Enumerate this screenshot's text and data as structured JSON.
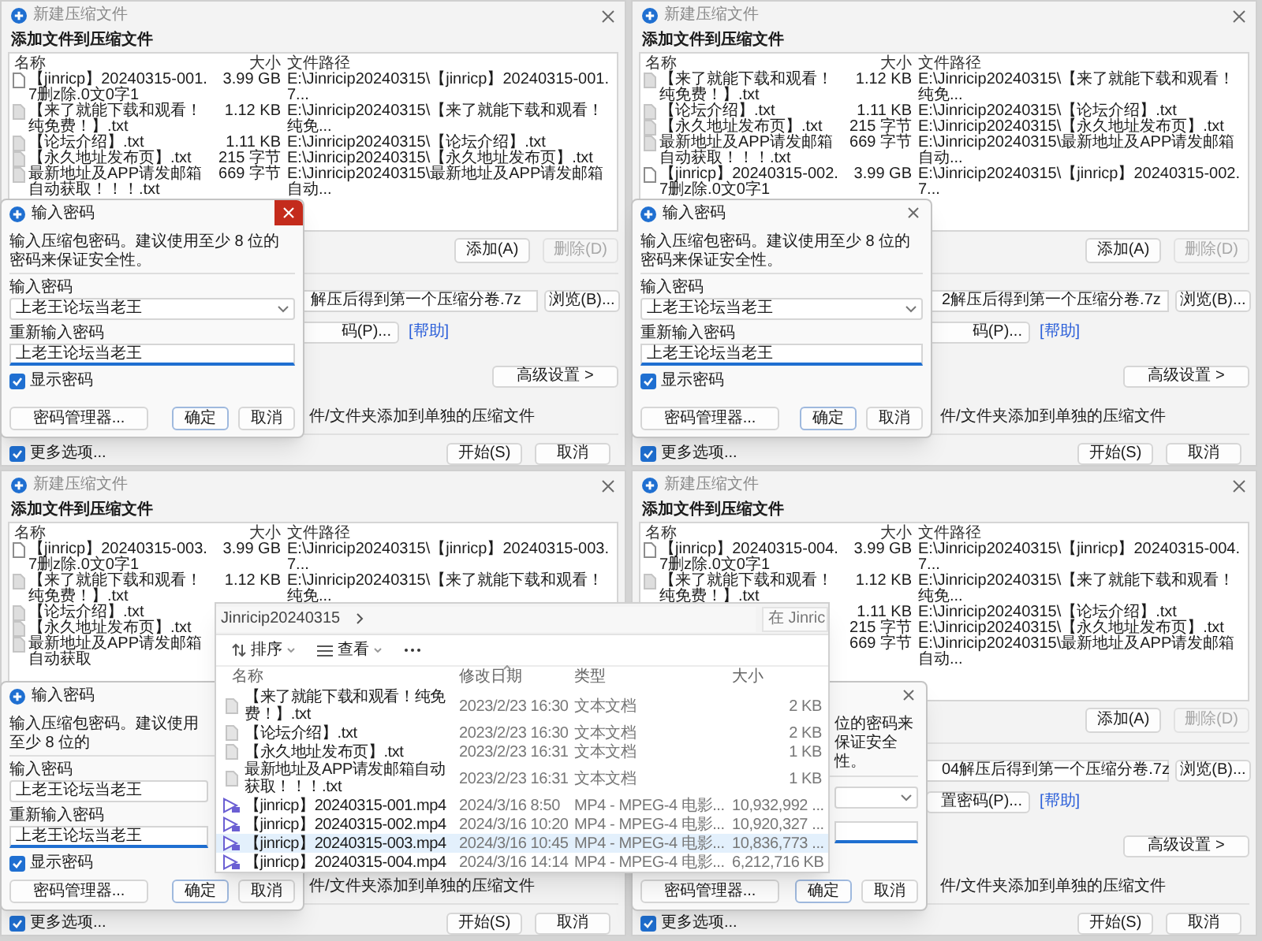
{
  "windows": [
    {
      "title": "新建压缩文件",
      "heading": "添加文件到压缩文件",
      "columns": [
        "名称",
        "大小",
        "文件路径"
      ],
      "rows": [
        {
          "kind": "archive",
          "name": "【jinricp】20240315-001.7删z除.0文0字1",
          "size": "3.99 GB",
          "path": "E:\\Jinricip20240315\\【jinricp】20240315-001.7..."
        },
        {
          "kind": "text",
          "name": "【来了就能下载和观看！纯免费！】.txt",
          "size": "1.12 KB",
          "path": "E:\\Jinricip20240315\\【来了就能下载和观看！纯免..."
        },
        {
          "kind": "text",
          "name": "【论坛介绍】.txt",
          "size": "1.11 KB",
          "path": "E:\\Jinricip20240315\\【论坛介绍】.txt"
        },
        {
          "kind": "text",
          "name": "【永久地址发布页】.txt",
          "size": "215 字节",
          "path": "E:\\Jinricip20240315\\【永久地址发布页】.txt"
        },
        {
          "kind": "text",
          "name": "最新地址及APP请发邮箱自动获取！！！.txt",
          "size": "669 字节",
          "path": "E:\\Jinricip20240315\\最新地址及APP请发邮箱自动..."
        }
      ],
      "add_button": "添加(A)",
      "delete_button": {
        "label": "删除(D)",
        "disabled": true
      },
      "archive_path": "解压后得到第一个压缩分卷.7z",
      "browse_button": "浏览(B)...",
      "password_button": "码(P)...",
      "help_link": "[帮助]",
      "advanced_button": "高级设置 >",
      "single_archive_option": "件/文件夹添加到单独的压缩文件",
      "more_options": {
        "label": "更多选项...",
        "checked": true
      },
      "start_button": "开始(S)",
      "cancel_button": "取消"
    },
    {
      "title": "新建压缩文件",
      "heading": "添加文件到压缩文件",
      "columns": [
        "名称",
        "大小",
        "文件路径"
      ],
      "rows": [
        {
          "kind": "text",
          "name": "【来了就能下载和观看！纯免费！】.txt",
          "size": "1.12 KB",
          "path": "E:\\Jinricip20240315\\【来了就能下载和观看！纯免..."
        },
        {
          "kind": "text",
          "name": "【论坛介绍】.txt",
          "size": "1.11 KB",
          "path": "E:\\Jinricip20240315\\【论坛介绍】.txt"
        },
        {
          "kind": "text",
          "name": "【永久地址发布页】.txt",
          "size": "215 字节",
          "path": "E:\\Jinricip20240315\\【永久地址发布页】.txt"
        },
        {
          "kind": "text",
          "name": "最新地址及APP请发邮箱自动获取！！！.txt",
          "size": "669 字节",
          "path": "E:\\Jinricip20240315\\最新地址及APP请发邮箱自动..."
        },
        {
          "kind": "archive",
          "name": "【jinricp】20240315-002.7删z除.0文0字1",
          "size": "3.99 GB",
          "path": "E:\\Jinricip20240315\\【jinricp】20240315-002.7..."
        }
      ],
      "add_button": "添加(A)",
      "delete_button": {
        "label": "删除(D)",
        "disabled": true
      },
      "archive_path": "2解压后得到第一个压缩分卷.7z",
      "browse_button": "浏览(B)...",
      "password_button": "码(P)...",
      "help_link": "[帮助]",
      "advanced_button": "高级设置 >",
      "single_archive_option": "件/文件夹添加到单独的压缩文件",
      "more_options": {
        "label": "更多选项...",
        "checked": true
      },
      "start_button": "开始(S)",
      "cancel_button": "取消"
    },
    {
      "title": "新建压缩文件",
      "heading": "添加文件到压缩文件",
      "columns": [
        "名称",
        "大小",
        "文件路径"
      ],
      "rows": [
        {
          "kind": "archive",
          "name": "【jinricp】20240315-003.7删z除.0文0字1",
          "size": "3.99 GB",
          "path": "E:\\Jinricip20240315\\【jinricp】20240315-003.7..."
        },
        {
          "kind": "text",
          "name": "【来了就能下载和观看！纯免费！】.txt",
          "size": "1.12 KB",
          "path": "E:\\Jinricip20240315\\【来了就能下载和观看！纯免..."
        },
        {
          "kind": "text",
          "name": "【论坛介绍】.txt"
        },
        {
          "kind": "text",
          "name": "【永久地址发布页】.txt"
        },
        {
          "kind": "text",
          "name": "最新地址及APP请发邮箱自动获取"
        }
      ],
      "single_archive_option": "件/文件夹添加到单独的压缩文件",
      "more_options": {
        "label": "更多选项...",
        "checked": true
      },
      "start_button": "开始(S)",
      "cancel_button": "取消"
    },
    {
      "title": "新建压缩文件",
      "heading": "添加文件到压缩文件",
      "columns": [
        "名称",
        "大小",
        "文件路径"
      ],
      "rows": [
        {
          "kind": "archive",
          "name": "【jinricp】20240315-004.7删z除.0文0字1",
          "size": "3.99 GB",
          "path": "E:\\Jinricip20240315\\【jinricp】20240315-004.7..."
        },
        {
          "kind": "text",
          "name": "【来了就能下载和观看！纯免费！】.txt",
          "size": "1.12 KB",
          "path": "E:\\Jinricip20240315\\【来了就能下载和观看！纯免..."
        },
        {
          "size": "1.11 KB",
          "path": "E:\\Jinricip20240315\\【论坛介绍】.txt"
        },
        {
          "size": "215 字节",
          "path": "E:\\Jinricip20240315\\【永久地址发布页】.txt"
        },
        {
          "size": "669 字节",
          "path": "E:\\Jinricip20240315\\最新地址及APP请发邮箱自动..."
        }
      ],
      "add_button": "添加(A)",
      "delete_button": {
        "label": "删除(D)",
        "disabled": true
      },
      "archive_path": "04解压后得到第一个压缩分卷.7z",
      "browse_button": "浏览(B)...",
      "password_button": "置密码(P)...",
      "help_link": "[帮助]",
      "advanced_button": "高级设置 >",
      "single_archive_option": "件/文件夹添加到单独的压缩文件",
      "more_options": {
        "label": "更多选项...",
        "checked": true
      },
      "start_button": "开始(S)",
      "cancel_button": "取消"
    }
  ],
  "dialogs": [
    {
      "kind": "full",
      "title": "输入密码",
      "close_button": {
        "hovered": true
      },
      "message": "输入压缩包密码。建议使用至少 8 位的密码来保证安全性。",
      "password_label": "输入密码",
      "password_value": "上老王论坛当老王",
      "confirm_label": "重新输入密码",
      "confirm_value": "上老王论坛当老王",
      "show_password": {
        "label": "显示密码",
        "checked": true
      },
      "manager_button": "密码管理器...",
      "ok_button": "确定",
      "cancel_button": "取消"
    },
    {
      "kind": "full",
      "title": "输入密码",
      "close_button": {
        "hovered": false
      },
      "message": "输入压缩包密码。建议使用至少 8 位的密码来保证安全性。",
      "password_label": "输入密码",
      "password_value": "上老王论坛当老王",
      "confirm_label": "重新输入密码",
      "confirm_value": "上老王论坛当老王",
      "show_password": {
        "label": "显示密码",
        "checked": true
      },
      "manager_button": "密码管理器...",
      "ok_button": "确定",
      "cancel_button": "取消"
    },
    {
      "kind": "right_covered",
      "title": "输入密码",
      "message": "输入压缩包密码。建议使用至少 8 位的",
      "password_label": "输入密码",
      "password_value": "上老王论坛当老王",
      "confirm_label": "重新输入密码",
      "confirm_value": "上老王论坛当老王",
      "show_password": {
        "label": "显示密码",
        "checked": true
      },
      "manager_button": "密码管理器...",
      "ok_button": "确定",
      "cancel_button": "取消"
    },
    {
      "kind": "left_covered",
      "close_button": {
        "hovered": false
      },
      "message": "位的密码来保证安全性。",
      "manager_button": "密码管理器...",
      "ok_button": "确定",
      "cancel_button": "取消"
    }
  ],
  "explorer": {
    "breadcrumb": "Jinricip20240315",
    "search_placeholder": "在 Jinric",
    "toolbar": [
      {
        "kind": "sort",
        "label": "排序"
      },
      {
        "kind": "view",
        "label": "查看"
      },
      {
        "kind": "more"
      }
    ],
    "columns": [
      "名称",
      "修改日期",
      "类型",
      "大小"
    ],
    "rows": [
      {
        "kind": "text",
        "name": "【来了就能下载和观看！纯免费！】.txt",
        "date": "2023/2/23 16:30",
        "type": "文本文档",
        "size": "2 KB",
        "selected": false
      },
      {
        "kind": "text",
        "name": "【论坛介绍】.txt",
        "date": "2023/2/23 16:30",
        "type": "文本文档",
        "size": "2 KB",
        "selected": false
      },
      {
        "kind": "text",
        "name": "【永久地址发布页】.txt",
        "date": "2023/2/23 16:31",
        "type": "文本文档",
        "size": "1 KB",
        "selected": false
      },
      {
        "kind": "text",
        "name": "最新地址及APP请发邮箱自动获取！！！.txt",
        "date": "2023/2/23 16:31",
        "type": "文本文档",
        "size": "1 KB",
        "selected": false
      },
      {
        "kind": "video",
        "name": "【jinricp】20240315-001.mp4",
        "date": "2024/3/16 8:50",
        "type": "MP4 - MPEG-4 电影...",
        "size": "10,932,992 ...",
        "selected": false
      },
      {
        "kind": "video",
        "name": "【jinricp】20240315-002.mp4",
        "date": "2024/3/16 10:20",
        "type": "MP4 - MPEG-4 电影...",
        "size": "10,920,327 ...",
        "selected": false
      },
      {
        "kind": "video",
        "name": "【jinricp】20240315-003.mp4",
        "date": "2024/3/16 10:45",
        "type": "MP4 - MPEG-4 电影...",
        "size": "10,836,773 ...",
        "selected": true
      },
      {
        "kind": "video",
        "name": "【jinricp】20240315-004.mp4",
        "date": "2024/3/16 14:14",
        "type": "MP4 - MPEG-4 电影...",
        "size": "6,212,716 KB",
        "selected": false
      }
    ]
  }
}
